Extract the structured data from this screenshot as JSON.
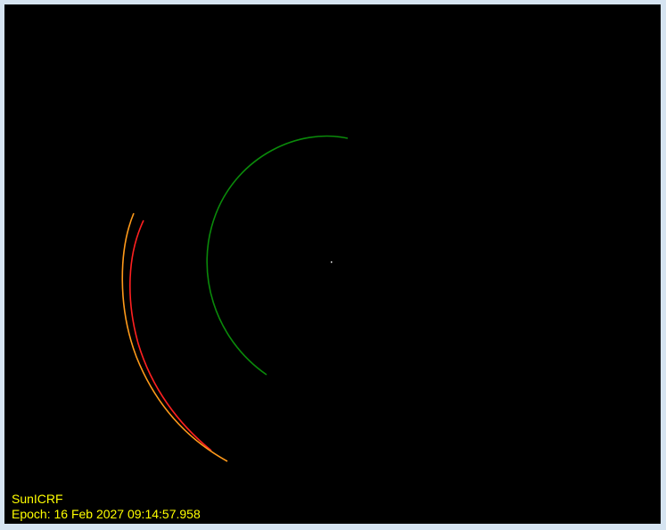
{
  "view": {
    "coordinate_system": "SunICRF",
    "epoch_text": "Epoch: 16 Feb 2027 09:14:57.958"
  },
  "colors": {
    "background": "#000000",
    "frame": "#d6e4f1",
    "hud_text": "#ffff00",
    "orbit_green": "#0a8a0a",
    "orbit_orange": "#ff9a1a",
    "orbit_red": "#ff2020",
    "center_marker": "#ffffff"
  }
}
